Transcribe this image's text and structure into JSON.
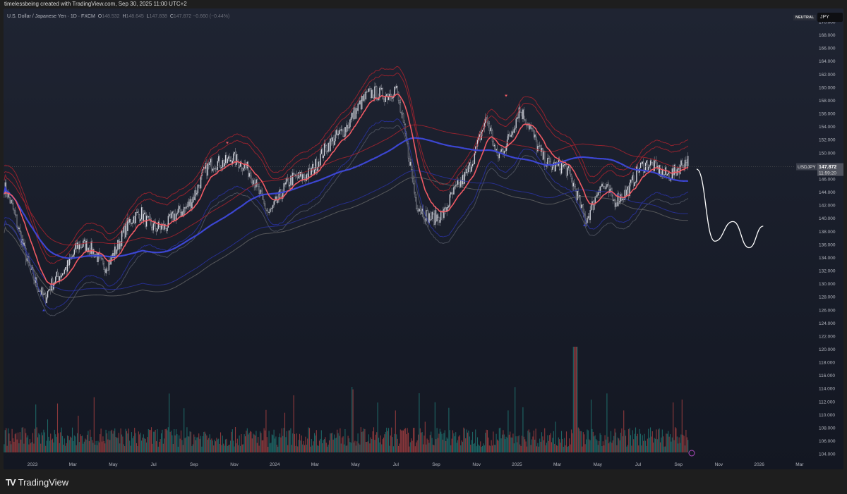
{
  "header": {
    "credit": "timelessbeing created with TradingView.com, Sep 30, 2025 11:00 UTC+2"
  },
  "legend": {
    "symbol_desc": "U.S. Dollar / Japanese Yen · 1D · FXCM",
    "open_label": "O",
    "open": "148.532",
    "high_label": "H",
    "high": "148.645",
    "low_label": "L",
    "low": "147.838",
    "close_label": "C",
    "close": "147.872",
    "change": "−0.660 (−0.44%)"
  },
  "badges": {
    "neutral": "NEUTRAL",
    "currency": "JPY"
  },
  "price_label": {
    "symbol": "USDJPY",
    "price": "147.872",
    "countdown": "11:59:20"
  },
  "brand": {
    "name": "TradingView"
  },
  "colors": {
    "up": "#26a69a",
    "down": "#ef5350",
    "ema": "#f05a64",
    "sma": "#3c46d2",
    "band_red": "#b0232e",
    "band_blue": "#2a33a8"
  },
  "chart_data": {
    "type": "line",
    "title": "USDJPY 1D",
    "xlabel": "",
    "ylabel": "JPY",
    "ylim": [
      103,
      171
    ],
    "y_ticks": [
      "170.000",
      "168.000",
      "166.000",
      "164.000",
      "162.000",
      "160.000",
      "158.000",
      "156.000",
      "154.000",
      "152.000",
      "150.000",
      "148.000",
      "146.000",
      "144.000",
      "142.000",
      "140.000",
      "138.000",
      "136.000",
      "134.000",
      "132.000",
      "130.000",
      "128.000",
      "126.000",
      "124.000",
      "122.000",
      "120.000",
      "118.000",
      "116.000",
      "114.000",
      "112.000",
      "110.000",
      "108.000",
      "106.000",
      "104.000"
    ],
    "x_ticks": [
      "2023",
      "Mar",
      "May",
      "Jul",
      "Sep",
      "Nov",
      "2024",
      "Mar",
      "May",
      "Jul",
      "Sep",
      "Nov",
      "2025",
      "Mar",
      "May",
      "Jul",
      "Sep",
      "Nov",
      "2026",
      "Mar"
    ],
    "x_unit": "months since Jan 2023",
    "close_keypoints": {
      "x": [
        -1.4,
        0.6,
        2.2,
        3.5,
        5.4,
        6.6,
        8.5,
        9.9,
        11.7,
        13.8,
        14.8,
        15.9,
        18.0,
        19.0,
        20.4,
        22.5,
        23.0,
        24.1,
        25.0,
        26.4,
        27.4,
        28.1,
        28.8,
        30.0,
        30.9,
        32.5
      ],
      "y": [
        144.3,
        127.0,
        136.2,
        133.0,
        141.0,
        137.8,
        146.4,
        150.2,
        141.6,
        148.0,
        150.7,
        156.6,
        160.5,
        142.0,
        140.0,
        154.5,
        149.0,
        156.6,
        150.7,
        147.0,
        140.5,
        145.0,
        142.0,
        147.5,
        147.3,
        147.9
      ]
    },
    "projection": {
      "x": [
        32.9,
        33.8,
        34.7,
        35.5,
        36.2
      ],
      "y": [
        147.5,
        136.5,
        139.5,
        135.5,
        138.8
      ]
    }
  }
}
